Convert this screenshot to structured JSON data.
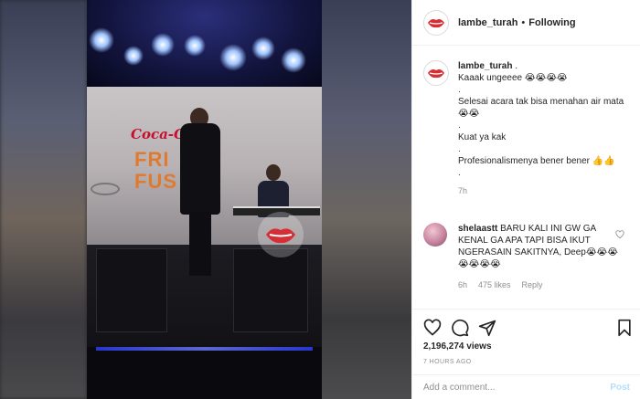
{
  "post": {
    "username": "lambe_turah",
    "follow_status": "Following",
    "separator": "•"
  },
  "caption": {
    "username": "lambe_turah",
    "lines": [
      ". ",
      "Kaaak ungeeee 😭😭😭😭",
      ".",
      "Selesai acara tak bisa menahan air mata😭😭",
      ".",
      "Kuat ya kak",
      ".",
      "Profesionalismenya bener bener 👍👍",
      "."
    ],
    "time": "7h"
  },
  "comment": {
    "username": "shelaastt",
    "text": "BARU KALI INI GW GA KENAL GA APA TAPI BISA IKUT NGERASAIN SAKITNYA, Deep😭😭😭😭😭😭😭",
    "time": "6h",
    "likes": "475 likes",
    "reply": "Reply"
  },
  "stats": {
    "views": "2,196,274 views",
    "posted_ago": "7 HOURS AGO"
  },
  "composer": {
    "placeholder": "Add a comment...",
    "post_label": "Post"
  },
  "video": {
    "brand_text": "Coca-Cola",
    "banner_line1": "FRI",
    "banner_line2": "FUS"
  },
  "icons": {
    "like": "heart-icon",
    "comment": "comment-icon",
    "share": "share-icon",
    "save": "bookmark-icon",
    "comment_like": "heart-small-icon"
  },
  "colors": {
    "lips_red": "#d62e35",
    "text": "#262626",
    "muted": "#8e8e8e",
    "post_disabled": "#b2dffc"
  }
}
